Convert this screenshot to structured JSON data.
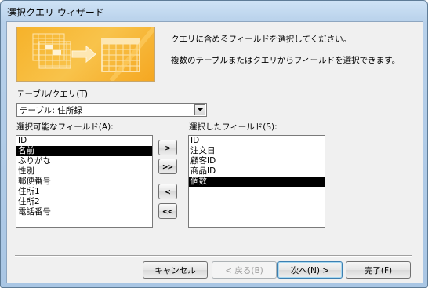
{
  "window": {
    "title": "選択クエリ ウィザード"
  },
  "messages": {
    "line1": "クエリに含めるフィールドを選択してください。",
    "line2": "複数のテーブルまたはクエリからフィールドを選択できます。"
  },
  "table_query": {
    "label": "テーブル/クエリ(T)",
    "selected": "テーブル: 住所録",
    "dropdown_icon": "dropdown-arrow-icon"
  },
  "available": {
    "label": "選択可能なフィールド(A):",
    "items": [
      "ID",
      "名前",
      "ふりがな",
      "性別",
      "郵便番号",
      "住所1",
      "住所2",
      "電話番号"
    ],
    "selected_index": 1
  },
  "selected_fields": {
    "label": "選択したフィールド(S):",
    "items": [
      "ID",
      "注文日",
      "顧客ID",
      "商品ID",
      "個数"
    ],
    "selected_index": 4
  },
  "move_buttons": {
    "add_one": ">",
    "add_all": ">>",
    "remove_one": "<",
    "remove_all": "<<"
  },
  "buttons": {
    "cancel": "キャンセル",
    "back": "< 戻る(B)",
    "next": "次へ(N) >",
    "finish": "完了(F)"
  },
  "colors": {
    "title_bar": "#b7d0ea",
    "header_image": "#f6b22a",
    "selection": "#000000"
  }
}
